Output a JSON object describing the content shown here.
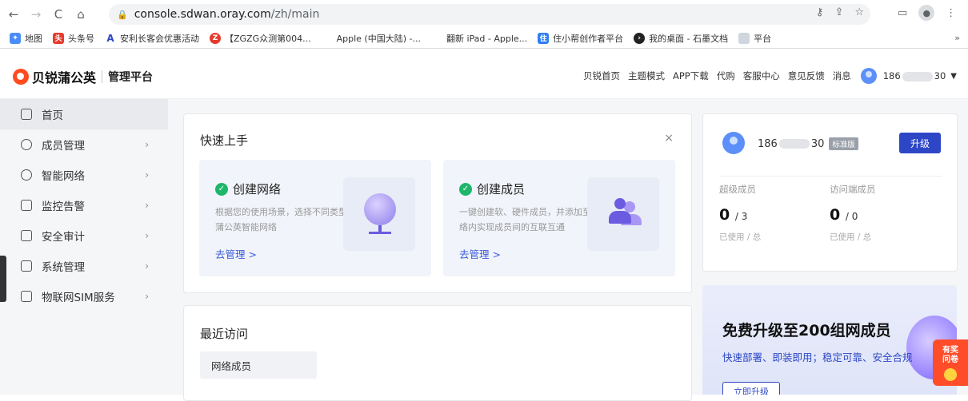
{
  "browser": {
    "url_host": "console.sdwan.oray.com",
    "url_path": "/zh/main",
    "bookmarks": [
      "地图",
      "头条号",
      "安利长客会优惠活动",
      "【ZGZG众测第004...",
      "Apple (中国大陆) -...",
      "翻新 iPad - Apple...",
      "住小帮创作者平台",
      "我的桌面 - 石墨文档",
      "平台"
    ],
    "more": "»"
  },
  "brand": {
    "name": "贝锐蒲公英",
    "sub": "管理平台"
  },
  "topnav": {
    "items": [
      "贝锐首页",
      "主题模式",
      "APP下载",
      "代购",
      "客服中心",
      "意见反馈",
      "消息"
    ],
    "user_prefix": "186",
    "user_suffix": "30"
  },
  "sidebar": {
    "items": [
      {
        "label": "首页"
      },
      {
        "label": "成员管理"
      },
      {
        "label": "智能网络"
      },
      {
        "label": "监控告警"
      },
      {
        "label": "安全审计"
      },
      {
        "label": "系统管理"
      },
      {
        "label": "物联网SIM服务"
      }
    ]
  },
  "quickstart": {
    "title": "快速上手",
    "close": "×",
    "items": [
      {
        "title": "创建网络",
        "desc": "根据您的使用场景，选择不同类型的蒲公英智能网络",
        "link": "去管理 >"
      },
      {
        "title": "创建成员",
        "desc": "一键创建软、硬件成员，并添加至网络内实现成员间的互联互通",
        "link": "去管理 >"
      }
    ]
  },
  "recent": {
    "title": "最近访问",
    "tag": "网络成员"
  },
  "account": {
    "name_prefix": "186",
    "name_suffix": "30",
    "badge": "标准版",
    "upgrade": "升级",
    "stats": [
      {
        "label": "超级成员",
        "used": "0",
        "total": "/ 3",
        "foot": "已使用 / 总"
      },
      {
        "label": "访问端成员",
        "used": "0",
        "total": "/ 0",
        "foot": "已使用 / 总"
      }
    ]
  },
  "promo": {
    "title": "免费升级至200组网成员",
    "desc": "快速部署、即装即用；稳定可靠、安全合规",
    "button": "立即升级"
  },
  "survey": {
    "line1": "有奖",
    "line2": "问卷"
  }
}
